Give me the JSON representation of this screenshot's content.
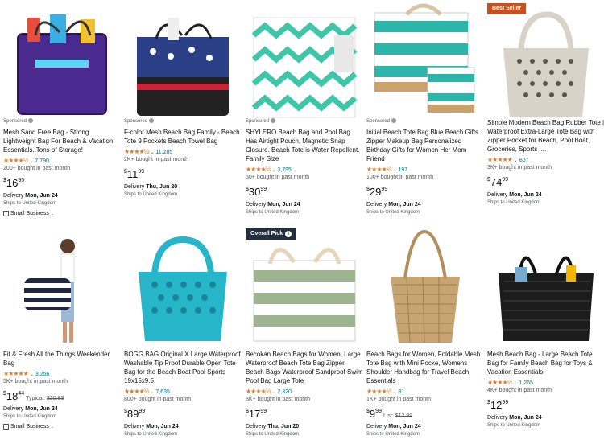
{
  "products": [
    {
      "badge": "",
      "sponsored": "Sponsored",
      "title": "Mesh Sand Free Bag - Strong Lightweight Bag For Beach & Vacation Essentials. Tons of Storage!",
      "stars": "★★★★½",
      "count": "7,790",
      "bought": "200+ bought in past month",
      "symbol": "$",
      "whole": "16",
      "frac": "95",
      "typical": "",
      "list": "",
      "delivery_pre": "Delivery ",
      "delivery_date": "Mon, Jun 24",
      "ships": "Ships to United Kingdom",
      "small_business": "Small Business"
    },
    {
      "badge": "",
      "sponsored": "Sponsored",
      "title": "F-color Mesh Beach Bag Family - Beach Tote 9 Pockets Beach Towel Bag",
      "stars": "★★★★½",
      "count": "11,285",
      "bought": "2K+ bought in past month",
      "symbol": "$",
      "whole": "11",
      "frac": "99",
      "typical": "",
      "list": "",
      "delivery_pre": "Delivery ",
      "delivery_date": "Thu, Jun 20",
      "ships": "Ships to United Kingdom",
      "small_business": ""
    },
    {
      "badge": "",
      "sponsored": "Sponsored",
      "title": "SHYLERO Beach Bag and Pool Bag Has Airtight Pouch, Magnetic Snap Closure. Beach Tote is Water Repellent. Family Size",
      "stars": "★★★★½",
      "count": "3,795",
      "bought": "50+ bought in past month",
      "symbol": "$",
      "whole": "30",
      "frac": "99",
      "typical": "",
      "list": "",
      "delivery_pre": "Delivery ",
      "delivery_date": "Mon, Jun 24",
      "ships": "Ships to United Kingdom",
      "small_business": ""
    },
    {
      "badge": "",
      "sponsored": "Sponsored",
      "title": "Initial Beach Tote Bag Blue Beach Gifts Zipper Makeup Bag Personalized Birthday Gifts for Women Her Mom Friend",
      "stars": "★★★★½",
      "count": "197",
      "bought": "100+ bought in past month",
      "symbol": "$",
      "whole": "29",
      "frac": "99",
      "typical": "",
      "list": "",
      "delivery_pre": "Delivery ",
      "delivery_date": "Mon, Jun 24",
      "ships": "Ships to United Kingdom",
      "small_business": ""
    },
    {
      "badge": "Best Seller",
      "sponsored": "",
      "title": "Simple Modern Beach Bag Rubber Tote | Waterproof Extra-Large Tote Bag with Zipper Pocket for Beach, Pool Boat, Groceries, Sports |...",
      "stars": "★★★★★",
      "count": "807",
      "bought": "3K+ bought in past month",
      "symbol": "$",
      "whole": "74",
      "frac": "99",
      "typical": "",
      "list": "",
      "delivery_pre": "Delivery ",
      "delivery_date": "Mon, Jun 24",
      "ships": "Ships to United Kingdom",
      "small_business": ""
    },
    {
      "badge": "",
      "sponsored": "",
      "title": "Fit & Fresh All the Things Weekender Bag",
      "stars": "★★★★★",
      "count": "3,256",
      "bought": "5K+ bought in past month",
      "symbol": "$",
      "whole": "18",
      "frac": "44",
      "typical": "Typical: ",
      "list": "$20.83",
      "delivery_pre": "Delivery ",
      "delivery_date": "Mon, Jun 24",
      "ships": "Ships to United Kingdom",
      "small_business": "Small Business"
    },
    {
      "badge": "",
      "sponsored": "",
      "title": "BOGG BAG Original X Large Waterproof Washable Tip Proof Durable Open Tote Bag for the Beach Boat Pool Sports 19x15x9.5",
      "stars": "★★★★½",
      "count": "7,635",
      "bought": "800+ bought in past month",
      "symbol": "$",
      "whole": "89",
      "frac": "99",
      "typical": "",
      "list": "",
      "delivery_pre": "Delivery ",
      "delivery_date": "Mon, Jun 24",
      "ships": "Ships to United Kingdom",
      "small_business": ""
    },
    {
      "badge": "Overall Pick",
      "sponsored": "",
      "title": "Becokan Beach Bags for Women, Large Waterproof Beach Tote Bag Zipper Beach Bags Waterproof Sandproof Swim Pool Bag Large Tote",
      "stars": "★★★★½",
      "count": "2,320",
      "bought": "3K+ bought in past month",
      "symbol": "$",
      "whole": "17",
      "frac": "99",
      "typical": "",
      "list": "",
      "delivery_pre": "Delivery ",
      "delivery_date": "Thu, Jun 20",
      "ships": "Ships to United Kingdom",
      "small_business": ""
    },
    {
      "badge": "",
      "sponsored": "",
      "title": "Beach Bags for Women, Foldable Mesh Tote Bag with Mini Pocke, Womens Shoulder Handbag for Travel Beach Essentials",
      "stars": "★★★★½",
      "count": "81",
      "bought": "1K+ bought in past month",
      "symbol": "$",
      "whole": "9",
      "frac": "99",
      "typical": "List: ",
      "list": "$12.99",
      "delivery_pre": "Delivery ",
      "delivery_date": "Mon, Jun 24",
      "ships": "Ships to United Kingdom",
      "small_business": ""
    },
    {
      "badge": "",
      "sponsored": "",
      "title": "Mesh Beach Bag - Large Beach Tote Bag for Family Beach Bag for Toys & Vacation Essentials",
      "stars": "★★★★½",
      "count": "1,265",
      "bought": "4K+ bought in past month",
      "symbol": "$",
      "whole": "12",
      "frac": "99",
      "typical": "",
      "list": "",
      "delivery_pre": "Delivery ",
      "delivery_date": "Mon, Jun 24",
      "ships": "Ships to United Kingdom",
      "small_business": ""
    }
  ],
  "icons": {
    "badge_info": "info-icon",
    "chevron": "chevron-down-icon",
    "small_business": "small-business-icon"
  },
  "colors": {
    "star": "#de7921",
    "link": "#007185",
    "best_seller": "#c7511f",
    "overall_pick": "#232f3e"
  }
}
